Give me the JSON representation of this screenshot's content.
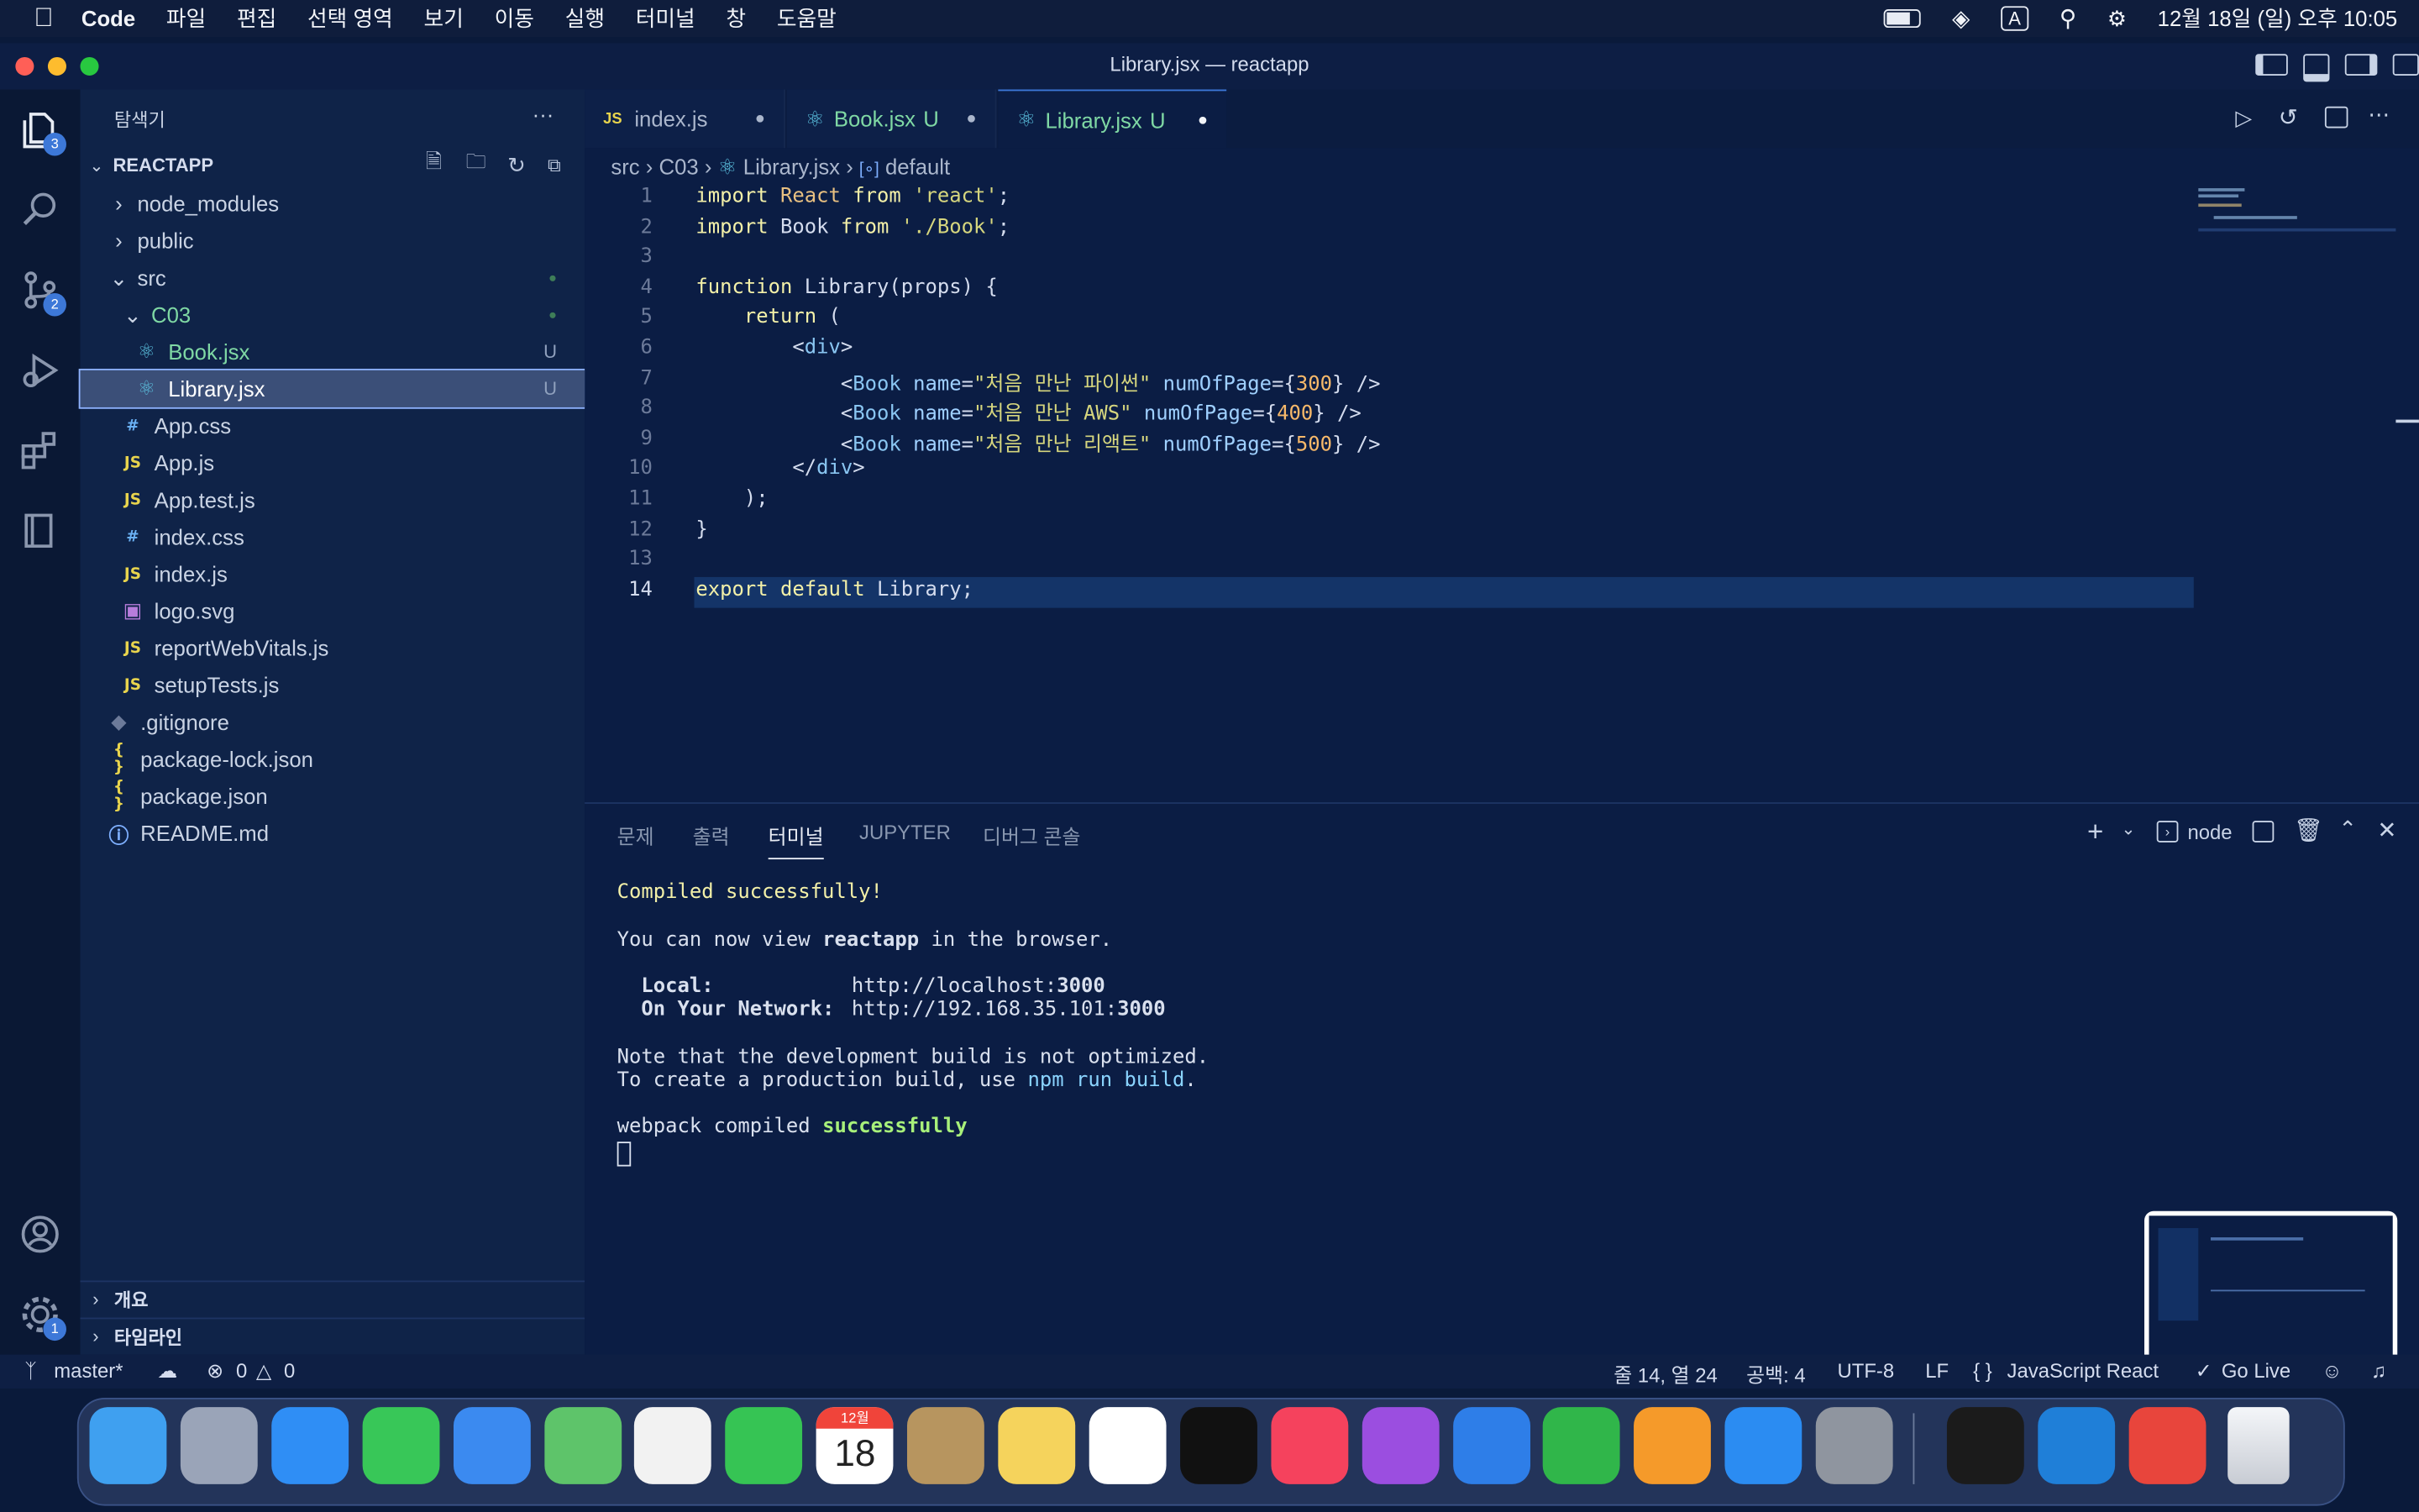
{
  "menubar": {
    "app_name": "Code",
    "items": [
      "파일",
      "편집",
      "선택 영역",
      "보기",
      "이동",
      "실행",
      "터미널",
      "창",
      "도움말"
    ],
    "clock": "12월 18일 (일) 오후 10:05",
    "input_indicator": "A"
  },
  "window": {
    "title": "Library.jsx — reactapp"
  },
  "activity": {
    "explorer_badge": "3",
    "scm_badge": "2",
    "settings_badge": "1"
  },
  "sidebar": {
    "header": "탐색기",
    "more": "···",
    "project": "REACTAPP",
    "tree": [
      {
        "label": "node_modules",
        "kind": "folder",
        "indent": 1,
        "open": false,
        "status": ""
      },
      {
        "label": "public",
        "kind": "folder",
        "indent": 1,
        "open": false,
        "status": ""
      },
      {
        "label": "src",
        "kind": "folder",
        "indent": 1,
        "open": true,
        "status": "●"
      },
      {
        "label": "C03",
        "kind": "folder",
        "indent": 2,
        "open": true,
        "status": "●"
      },
      {
        "label": "Book.jsx",
        "kind": "react",
        "indent": 3,
        "status": "U"
      },
      {
        "label": "Library.jsx",
        "kind": "react",
        "indent": 3,
        "status": "U",
        "selected": true
      },
      {
        "label": "App.css",
        "kind": "css",
        "indent": 2,
        "status": ""
      },
      {
        "label": "App.js",
        "kind": "js",
        "indent": 2,
        "status": ""
      },
      {
        "label": "App.test.js",
        "kind": "js",
        "indent": 2,
        "status": ""
      },
      {
        "label": "index.css",
        "kind": "css",
        "indent": 2,
        "status": ""
      },
      {
        "label": "index.js",
        "kind": "js",
        "indent": 2,
        "status": ""
      },
      {
        "label": "logo.svg",
        "kind": "svg",
        "indent": 2,
        "status": ""
      },
      {
        "label": "reportWebVitals.js",
        "kind": "js",
        "indent": 2,
        "status": ""
      },
      {
        "label": "setupTests.js",
        "kind": "js",
        "indent": 2,
        "status": ""
      },
      {
        "label": ".gitignore",
        "kind": "git",
        "indent": 1,
        "status": ""
      },
      {
        "label": "package-lock.json",
        "kind": "json",
        "indent": 1,
        "status": ""
      },
      {
        "label": "package.json",
        "kind": "json",
        "indent": 1,
        "status": ""
      },
      {
        "label": "README.md",
        "kind": "info",
        "indent": 1,
        "status": ""
      }
    ],
    "outline": "개요",
    "timeline": "타임라인"
  },
  "tabs": [
    {
      "label": "index.js",
      "icon": "JS",
      "suffix": "",
      "dirty": true,
      "active": false
    },
    {
      "label": "Book.jsx",
      "icon": "react",
      "suffix": "U",
      "dirty": true,
      "active": false
    },
    {
      "label": "Library.jsx",
      "icon": "react",
      "suffix": "U",
      "dirty": true,
      "active": true
    }
  ],
  "breadcrumb": [
    "src",
    "C03",
    "Library.jsx",
    "default"
  ],
  "code_lines": [
    "import React from 'react';",
    "import Book from './Book';",
    "",
    "function Library(props) {",
    "    return (",
    "        <div>",
    "            <Book name=\"처음 만난 파이썬\" numOfPage={300} />",
    "            <Book name=\"처음 만난 AWS\" numOfPage={400} />",
    "            <Book name=\"처음 만난 리액트\" numOfPage={500} />",
    "        </div>",
    "    );",
    "}",
    "",
    "export default Library;"
  ],
  "panel": {
    "tabs": [
      "문제",
      "출력",
      "터미널",
      "JUPYTER",
      "디버그 콘솔"
    ],
    "active_tab": "터미널",
    "shell": "node",
    "terminal": {
      "compiled": "Compiled successfully!",
      "view_pre": "You can now view ",
      "app": "reactapp",
      "view_post": " in the browser.",
      "local_label": "  Local:",
      "local_url_pre": "http://localhost:",
      "local_port": "3000",
      "network_label": "  On Your Network:",
      "network_url_pre": "http://192.168.35.101:",
      "network_port": "3000",
      "note1": "Note that the development build is not optimized.",
      "note2_pre": "To create a production build, use ",
      "note2_cmd": "npm run build",
      "note2_post": ".",
      "webpack_pre": "webpack compiled ",
      "webpack_ok": "successfully"
    }
  },
  "statusbar": {
    "branch": "master*",
    "errors": "0",
    "warnings": "0",
    "position": "줄 14, 열 24",
    "spaces": "공백: 4",
    "encoding": "UTF-8",
    "eol": "LF",
    "language": "JavaScript React",
    "golive": "Go Live"
  },
  "dock": {
    "calendar_month": "12월",
    "calendar_day": "18",
    "apps": [
      "finder-icon",
      "launchpad-icon",
      "safari-icon",
      "messages-icon",
      "mail-icon",
      "maps-icon",
      "photos-icon",
      "facetime-icon",
      "calendar-icon",
      "contacts-icon",
      "notes-icon",
      "reminders-icon",
      "appletv-icon",
      "music-icon",
      "podcasts-icon",
      "keynote-icon",
      "numbers-icon",
      "pages-icon",
      "appstore-icon",
      "settings-icon",
      "terminal-icon",
      "vscode-icon",
      "chrome-icon",
      "trash-icon"
    ]
  }
}
